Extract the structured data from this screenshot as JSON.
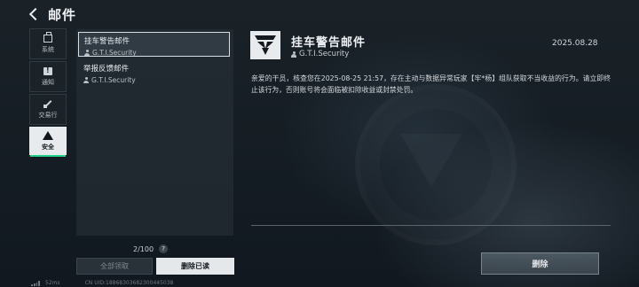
{
  "header": {
    "title": "邮件"
  },
  "sidebar": {
    "items": [
      {
        "label": "系统",
        "icon": "briefcase-icon"
      },
      {
        "label": "通知",
        "icon": "notice-icon"
      },
      {
        "label": "交易行",
        "icon": "hammer-icon"
      },
      {
        "label": "安全",
        "icon": "warning-icon",
        "active": true
      }
    ]
  },
  "mail_list": {
    "items": [
      {
        "title": "挂车警告邮件",
        "sender": "G.T.I.Security",
        "selected": true
      },
      {
        "title": "举报反馈邮件",
        "sender": "G.T.I.Security",
        "selected": false
      }
    ],
    "count": "2/100",
    "help_glyph": "?",
    "claim_all_label": "全部领取",
    "delete_read_label": "删除已读"
  },
  "status_bar": {
    "latency": "52ms",
    "uid": "CN UID:18868303682300445038"
  },
  "detail": {
    "title": "挂车警告邮件",
    "sender": "G.T.I.Security",
    "date": "2025.08.28",
    "body": "亲爱的干员，核查您在2025-08-25 21:57，存在主动与数据异常玩家【牢*杨】组队获取不当收益的行为。请立即终止该行为，否则账号将会面临被扣除收益或封禁处罚。",
    "delete_label": "删除"
  },
  "colors": {
    "accent_green": "#23d18b",
    "background": "#141b21",
    "active_tab": "#e8ebee"
  }
}
